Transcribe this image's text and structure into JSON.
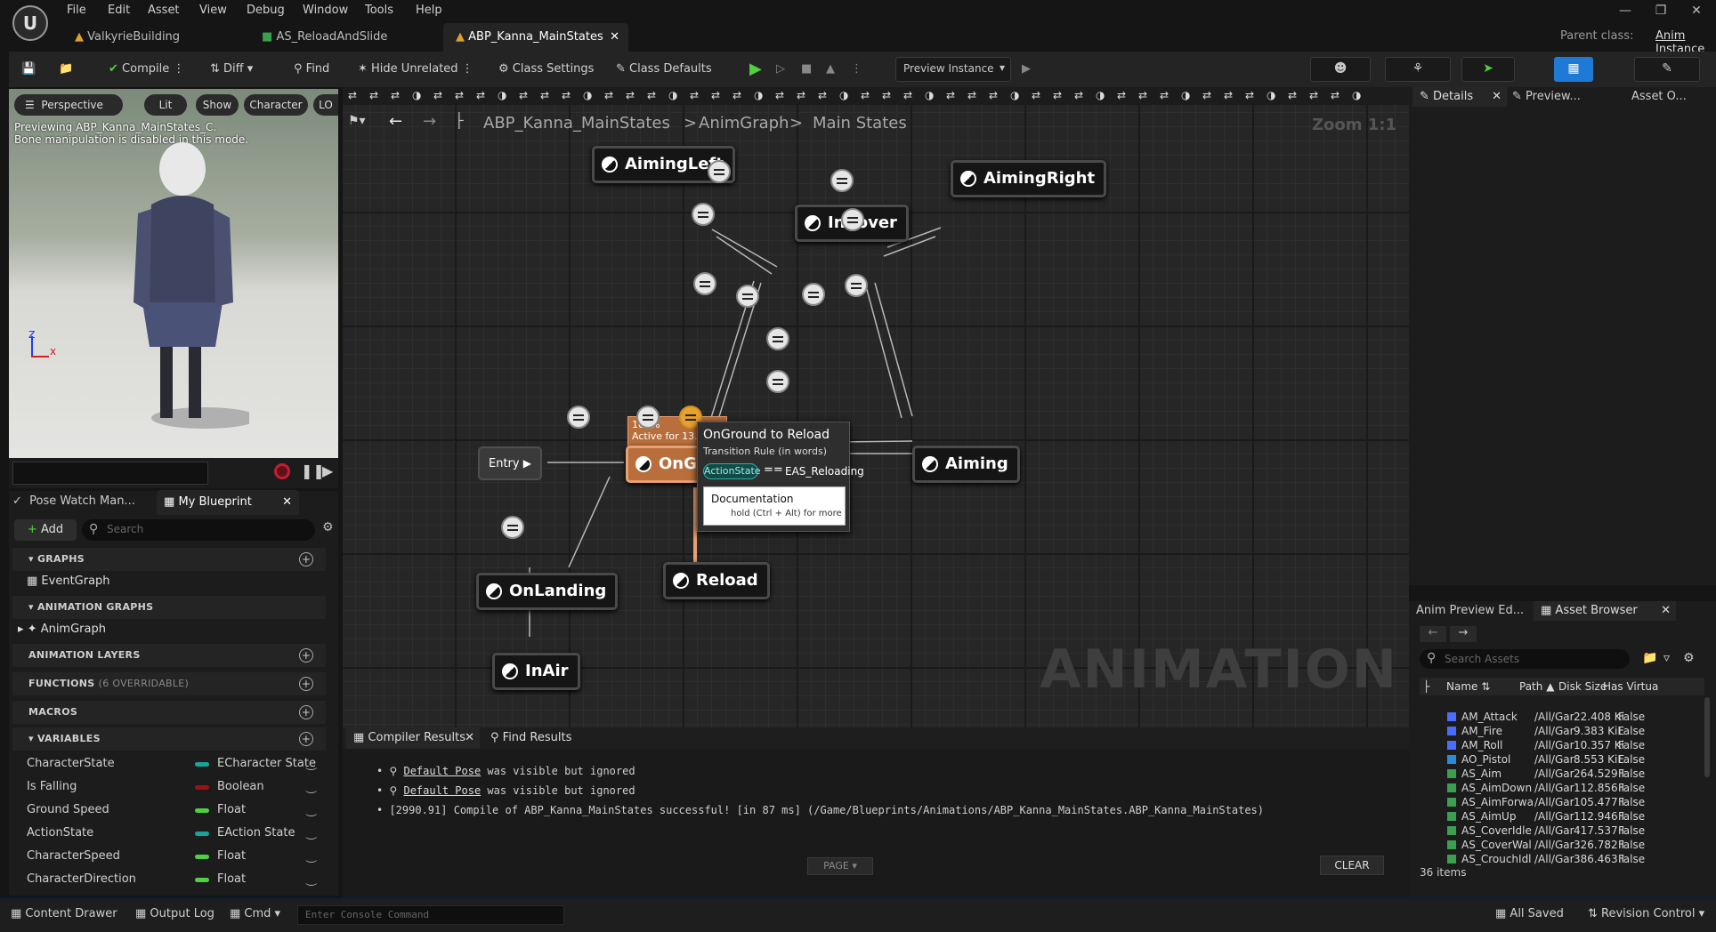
{
  "menu": [
    "File",
    "Edit",
    "Asset",
    "View",
    "Debug",
    "Window",
    "Tools",
    "Help"
  ],
  "tabs": [
    "ValkyrieBuilding",
    "AS_ReloadAndSlide",
    "ABP_Kanna_MainStates"
  ],
  "parent_class": {
    "label": "Parent class:",
    "value": "Anim Instance"
  },
  "toolbar": {
    "compile": "Compile",
    "diff": "Diff",
    "find": "Find",
    "hide_unrelated": "Hide Unrelated",
    "class_settings": "Class Settings",
    "class_defaults": "Class Defaults",
    "preview_instance": "Preview Instance"
  },
  "viewport": {
    "perspective": "Perspective",
    "lit": "Lit",
    "show": "Show",
    "character": "Character",
    "lod": "LO",
    "msg1": "Previewing ABP_Kanna_MainStates_C.",
    "msg2": "Bone manipulation is disabled in this mode."
  },
  "left_tabs": {
    "pose_watch": "Pose Watch Man...",
    "my_blueprint": "My Blueprint"
  },
  "add_label": "Add",
  "search_placeholder": "Search",
  "sections": {
    "graphs": "GRAPHS",
    "event_graph": "EventGraph",
    "anim_graphs": "ANIMATION GRAPHS",
    "anim_graph": "AnimGraph",
    "anim_layers": "ANIMATION LAYERS",
    "functions": "FUNCTIONS",
    "functions_note": "(6 OVERRIDABLE)",
    "macros": "MACROS",
    "variables": "VARIABLES"
  },
  "variables": [
    {
      "name": "CharacterState",
      "type": "ECharacter State",
      "color": "#1aa39a"
    },
    {
      "name": "Is Falling",
      "type": "Boolean",
      "color": "#a01010"
    },
    {
      "name": "Ground Speed",
      "type": "Float",
      "color": "#50d040"
    },
    {
      "name": "ActionState",
      "type": "EAction State",
      "color": "#1aa39a"
    },
    {
      "name": "CharacterSpeed",
      "type": "Float",
      "color": "#50d040"
    },
    {
      "name": "CharacterDirection",
      "type": "Float",
      "color": "#50d040"
    }
  ],
  "breadcrumb": {
    "root": "ABP_Kanna_MainStates",
    "sep1": ">",
    "graph": "AnimGraph",
    "sep2": ">",
    "current": "Main States"
  },
  "zoom": "Zoom 1:1",
  "watermark": "ANIMATION",
  "states": {
    "aiming_left": "AimingLeft",
    "aiming_right": "AimingRight",
    "in_cover": "InCover",
    "on_ground": "OnGround",
    "aiming": "Aiming",
    "reload": "Reload",
    "on_landing": "OnLanding",
    "in_air": "InAir",
    "entry": "Entry"
  },
  "active_badge": {
    "percent": "100%",
    "text": "Active for 13.936s"
  },
  "tooltip": {
    "title": "OnGround to Reload",
    "subtitle": "Transition Rule (in words)",
    "var": "ActionState",
    "op": "==",
    "value": "EAS_Reloading",
    "doc_title": "Documentation",
    "doc_hint": "hold (Ctrl + Alt) for more"
  },
  "console": {
    "tab1": "Compiler Results",
    "tab2": "Find Results",
    "lines": [
      {
        "link": "Default Pose",
        "rest": " was visible but ignored"
      },
      {
        "link": "Default Pose",
        "rest": " was visible but ignored"
      }
    ],
    "line3": "[2990.91] Compile of ABP_Kanna_MainStates successful! [in 87 ms] (/Game/Blueprints/Animations/ABP_Kanna_MainStates.ABP_Kanna_MainStates)",
    "page": "PAGE",
    "clear": "CLEAR"
  },
  "right_tabs": {
    "details": "Details",
    "preview": "Preview...",
    "asset_o": "Asset O...",
    "anim_preview": "Anim Preview Ed...",
    "asset_browser": "Asset Browser"
  },
  "asset_search": "Search Assets",
  "asset_cols": [
    "Name",
    "Path",
    "Disk Size",
    "Has Virtua"
  ],
  "assets": [
    {
      "name": "AM_Attack",
      "path": "/All/Gar",
      "size": "22.408 Ki",
      "virt": "False",
      "color": "#4a6cff"
    },
    {
      "name": "AM_Fire",
      "path": "/All/Gar",
      "size": "9.383 KiE",
      "virt": "False",
      "color": "#4a6cff"
    },
    {
      "name": "AM_Roll",
      "path": "/All/Gar",
      "size": "10.357 Ki",
      "virt": "False",
      "color": "#4a6cff"
    },
    {
      "name": "AO_Pistol",
      "path": "/All/Gar",
      "size": "8.553 KiE",
      "virt": "False",
      "color": "#2a8cd8"
    },
    {
      "name": "AS_Aim",
      "path": "/All/Gar",
      "size": "264.529 I",
      "virt": "False",
      "color": "#3aa050"
    },
    {
      "name": "AS_AimDown",
      "path": "/All/Gar",
      "size": "112.856 I",
      "virt": "False",
      "color": "#3aa050"
    },
    {
      "name": "AS_AimForwa",
      "path": "/All/Gar",
      "size": "105.477 I",
      "virt": "False",
      "color": "#3aa050"
    },
    {
      "name": "AS_AimUp",
      "path": "/All/Gar",
      "size": "112.946 I",
      "virt": "False",
      "color": "#3aa050"
    },
    {
      "name": "AS_CoverIdle",
      "path": "/All/Gar",
      "size": "417.537 I",
      "virt": "False",
      "color": "#3aa050"
    },
    {
      "name": "AS_CoverWal",
      "path": "/All/Gar",
      "size": "326.782 I",
      "virt": "False",
      "color": "#3aa050"
    },
    {
      "name": "AS_CrouchIdl",
      "path": "/All/Gar",
      "size": "386.463 I",
      "virt": "False",
      "color": "#3aa050"
    }
  ],
  "item_count": "36 items",
  "status": {
    "content_drawer": "Content Drawer",
    "output_log": "Output Log",
    "cmd": "Cmd",
    "console_placeholder": "Enter Console Command",
    "all_saved": "All Saved",
    "revision": "Revision Control"
  }
}
